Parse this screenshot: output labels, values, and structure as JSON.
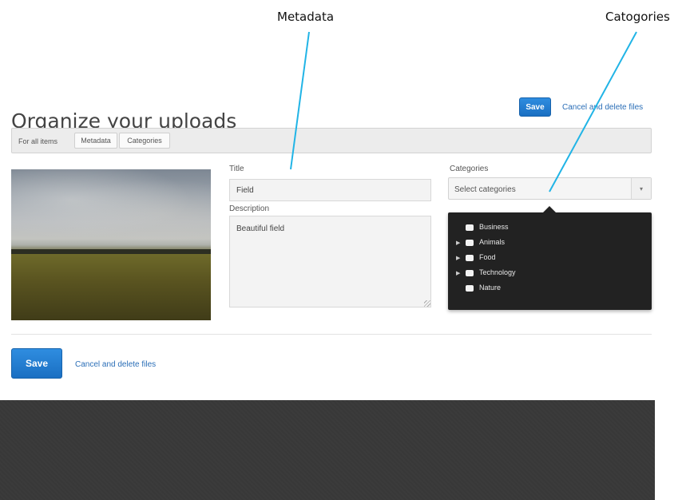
{
  "annotations": {
    "metadata_label": "Metadata",
    "categories_label": "Catogories"
  },
  "header": {
    "title": "Organize your uploads",
    "save_label": "Save",
    "cancel_label": "Cancel and delete files"
  },
  "toolbar": {
    "label": "For all items",
    "tabs": [
      {
        "label": "Metadata"
      },
      {
        "label": "Categories"
      }
    ]
  },
  "item": {
    "title_label": "Title",
    "title_value": "Field",
    "description_label": "Description",
    "description_value": "Beautiful field",
    "categories_label": "Categories",
    "categories_placeholder": "Select categories",
    "category_options": [
      {
        "label": "Business",
        "expandable": false
      },
      {
        "label": "Animals",
        "expandable": true
      },
      {
        "label": "Food",
        "expandable": true
      },
      {
        "label": "Technology",
        "expandable": true
      },
      {
        "label": "Nature",
        "expandable": false
      }
    ]
  },
  "footer_actions": {
    "save_label": "Save",
    "cancel_label": "Cancel and delete files"
  },
  "colors": {
    "accent": "#1f7dd4",
    "annotation_line": "#21b4e6",
    "dropdown_bg": "#222222",
    "footer_bg": "#383838"
  }
}
